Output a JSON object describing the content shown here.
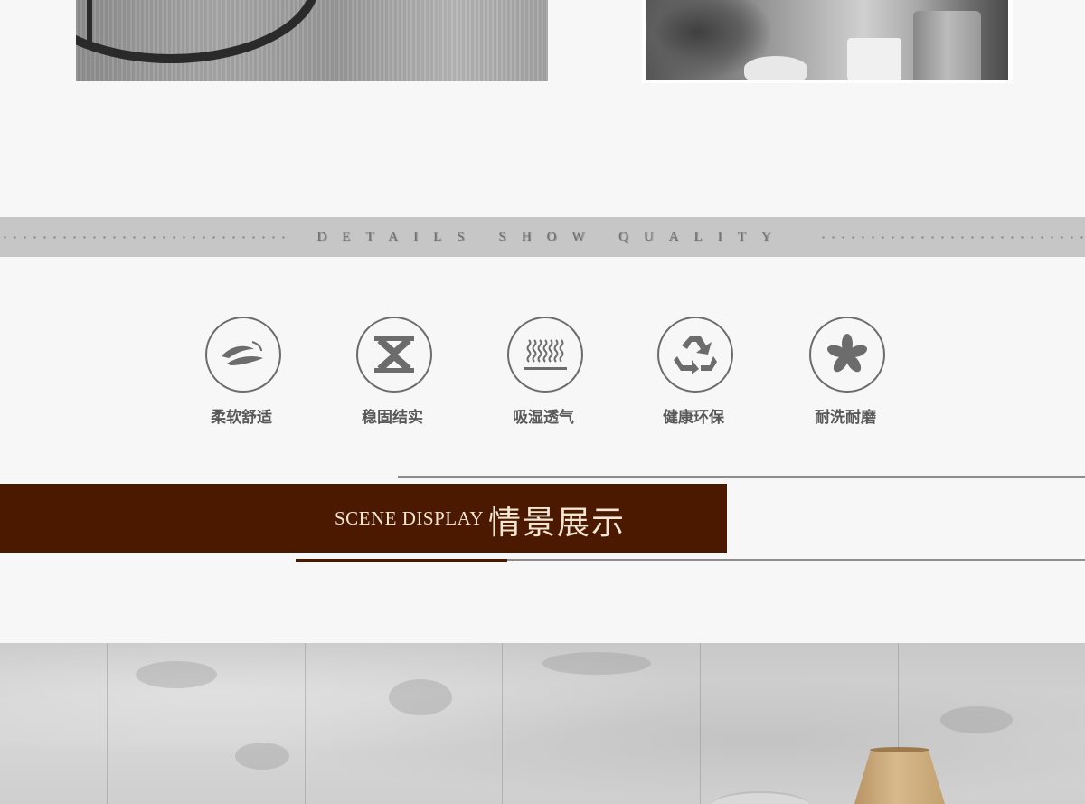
{
  "details_band": {
    "text": "DETAILS SHOW QUALITY"
  },
  "features": [
    {
      "label": "柔软舒适",
      "icon": "feather-icon"
    },
    {
      "label": "稳固结实",
      "icon": "hourglass-x-icon"
    },
    {
      "label": "吸湿透气",
      "icon": "wave-lines-icon"
    },
    {
      "label": "健康环保",
      "icon": "recycle-icon"
    },
    {
      "label": "耐洗耐磨",
      "icon": "asterisk-icon"
    }
  ],
  "scene": {
    "title_en": "SCENE DISPLAY",
    "title_cn": "情景展示"
  },
  "colors": {
    "brown_accent": "#4b1800",
    "band_gray": "#c6c6c6",
    "text_gray": "#585858"
  }
}
